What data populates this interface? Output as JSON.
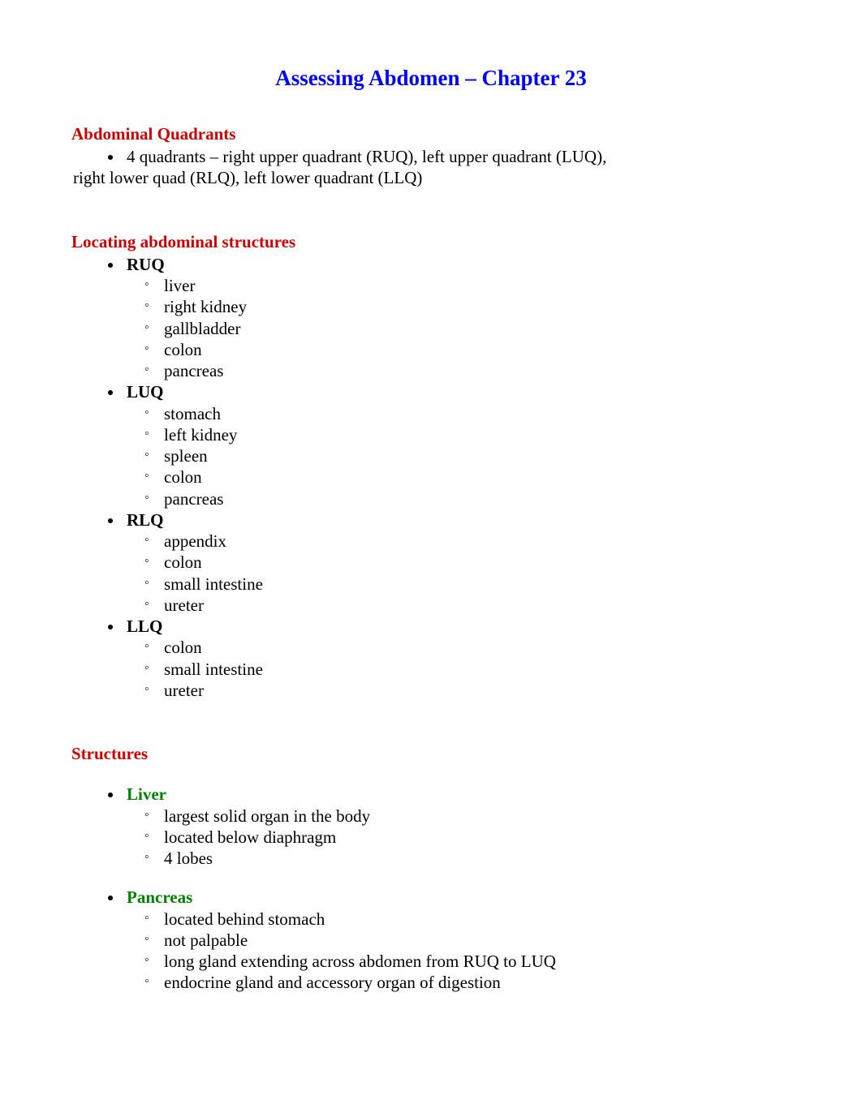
{
  "title": "Assessing Abdomen – Chapter 23",
  "section1": {
    "heading": "Abdominal Quadrants",
    "bullet1": "4 quadrants – right upper quadrant (RUQ), left upper quadrant (LUQ),",
    "wrap": "right lower quad (RLQ), left lower quadrant (LLQ)"
  },
  "section2": {
    "heading": "Locating abdominal structures",
    "groups": [
      {
        "name": "RUQ",
        "items": [
          "liver",
          "right kidney",
          "gallbladder",
          "colon",
          "pancreas"
        ]
      },
      {
        "name": "LUQ",
        "items": [
          "stomach",
          "left kidney",
          "spleen",
          "colon",
          "pancreas"
        ]
      },
      {
        "name": "RLQ",
        "items": [
          "appendix",
          "colon",
          "small intestine",
          "ureter"
        ]
      },
      {
        "name": "LLQ",
        "items": [
          "colon",
          "small intestine",
          "ureter"
        ]
      }
    ]
  },
  "section3": {
    "heading": "Structures",
    "groups": [
      {
        "name": "Liver",
        "items": [
          "largest solid organ in the body",
          "located below diaphragm",
          "4 lobes"
        ]
      },
      {
        "name": "Pancreas",
        "items": [
          "located behind stomach",
          "not palpable",
          "long gland extending across abdomen from RUQ to LUQ",
          "endocrine gland and accessory organ of digestion"
        ]
      }
    ]
  }
}
